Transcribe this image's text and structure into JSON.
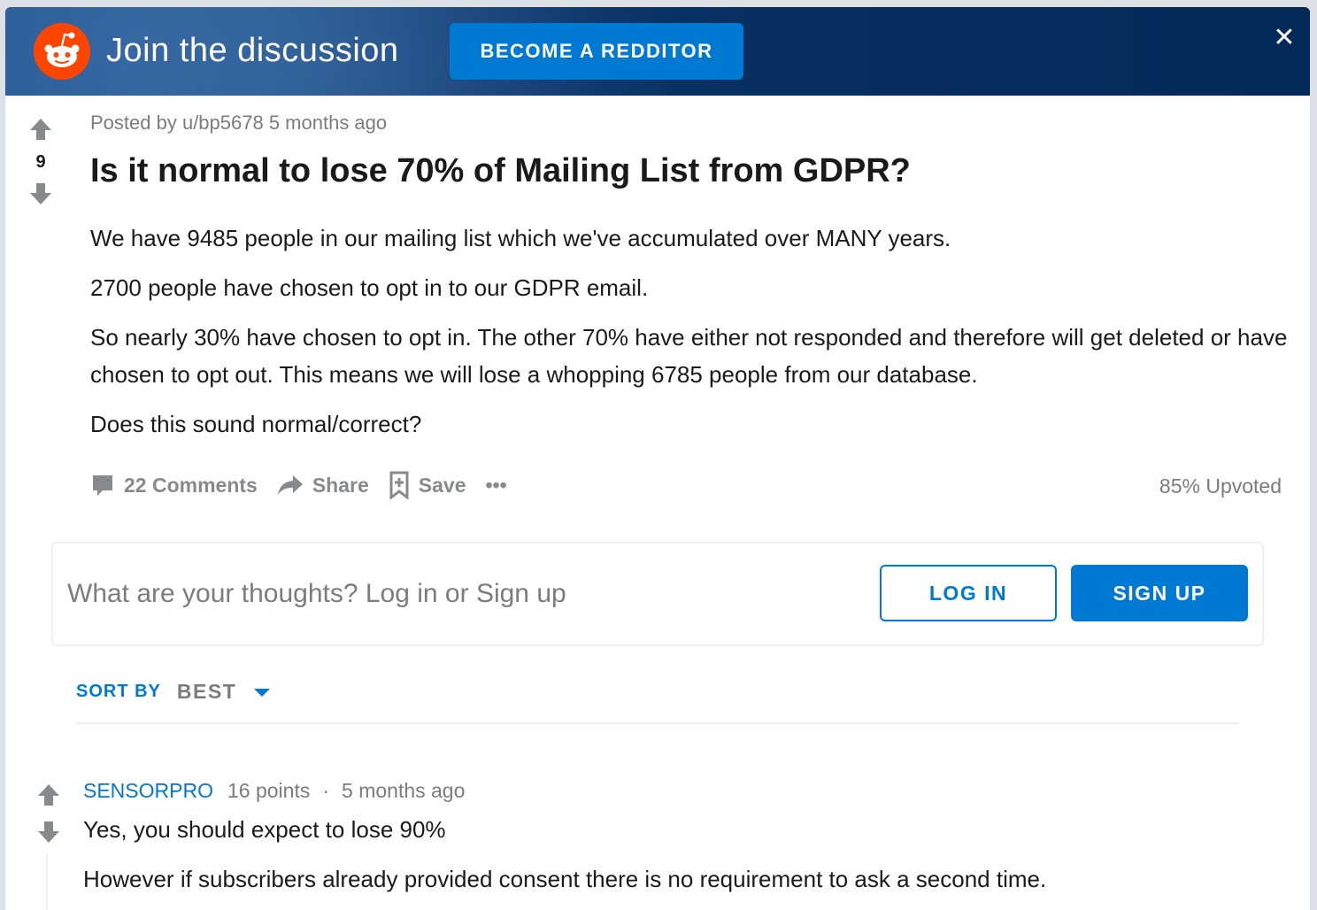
{
  "banner": {
    "title": "Join the discussion",
    "cta_label": "BECOME A REDDITOR",
    "close_glyph": "✕"
  },
  "post": {
    "meta": "Posted by u/bp5678 5 months ago",
    "score": "9",
    "title": "Is it normal to lose 70% of Mailing List from GDPR?",
    "body": [
      "We have 9485 people in our mailing list which we've accumulated over MANY years.",
      "2700 people have chosen to opt in to our GDPR email.",
      "So nearly 30% have chosen to opt in. The other 70% have either not responded and therefore will get deleted or have chosen to opt out. This means we will lose a whopping 6785 people from our database.",
      "Does this sound normal/correct?"
    ],
    "actions": {
      "comments": "22 Comments",
      "share": "Share",
      "save": "Save",
      "more": "•••"
    },
    "upvoted": "85% Upvoted"
  },
  "comment_box": {
    "prompt": "What are your thoughts? Log in or Sign up",
    "login_label": "LOG IN",
    "signup_label": "SIGN UP"
  },
  "sort": {
    "label": "SORT BY",
    "value": "BEST"
  },
  "comments": [
    {
      "author": "SENSORPRO",
      "points": "16 points",
      "separator": "·",
      "time": "5 months ago",
      "body": [
        "Yes, you should expect to lose 90%",
        "However if subscribers already provided consent there is no requirement to ask a second time."
      ]
    }
  ],
  "colors": {
    "accent": "#0079d3",
    "brand": "#ff4500",
    "banner_bg": "#042a59",
    "muted_text": "#7c7c7c"
  }
}
